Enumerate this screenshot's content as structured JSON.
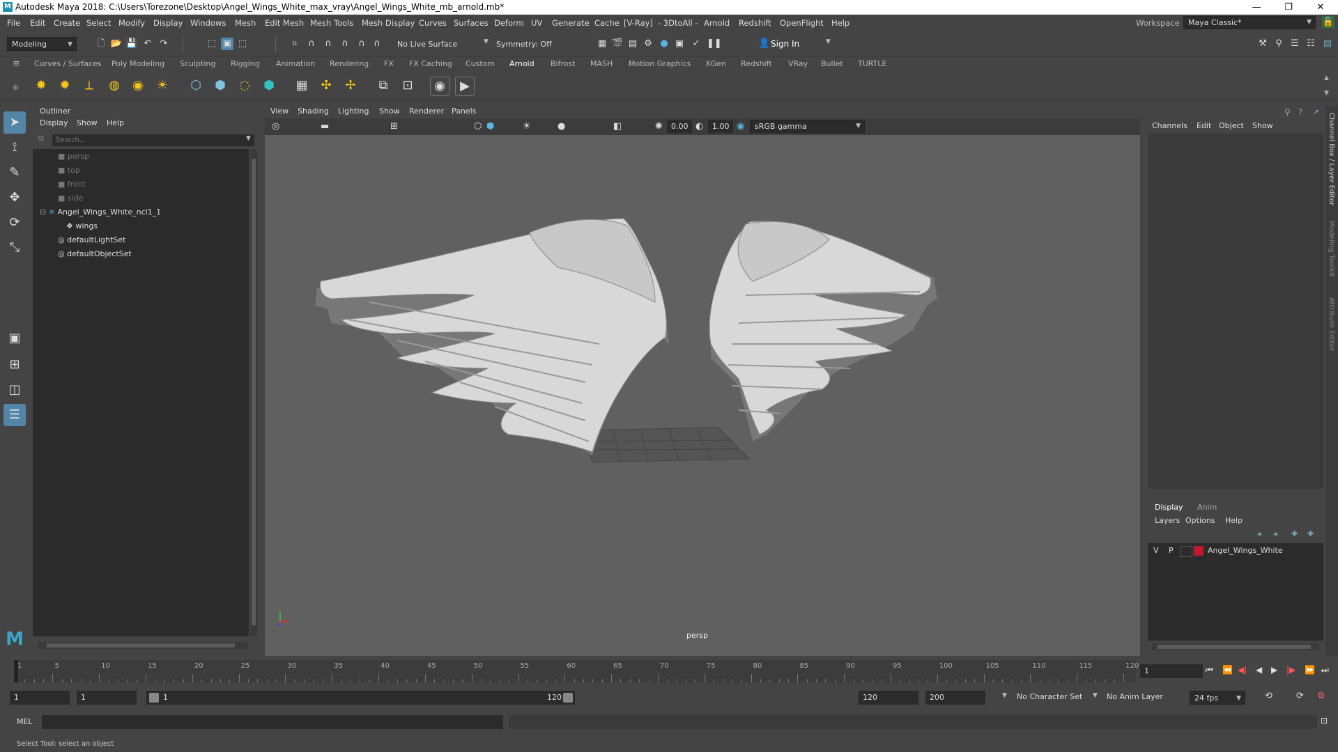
{
  "window": {
    "title": "Autodesk Maya 2018: C:\\Users\\Torezone\\Desktop\\Angel_Wings_White_max_vray\\Angel_Wings_White_mb_arnold.mb*",
    "minimize": "—",
    "maximize": "❐",
    "close": "✕"
  },
  "menubar": {
    "items": [
      "File",
      "Edit",
      "Create",
      "Select",
      "Modify",
      "Display",
      "Windows",
      "Mesh",
      "Edit Mesh",
      "Mesh Tools",
      "Mesh Display",
      "Curves",
      "Surfaces",
      "Deform",
      "UV",
      "Generate",
      "Cache",
      "[V-Ray]",
      "- 3DtoAll -",
      "Arnold",
      "Redshift",
      "OpenFlight",
      "Help"
    ],
    "workspace_label": "Workspace :",
    "workspace_value": "Maya Classic*"
  },
  "statusline": {
    "mode": "Modeling",
    "live_surface": "No Live Surface",
    "symmetry": "Symmetry: Off",
    "sign_in": "Sign In"
  },
  "shelf_tabs": [
    "Curves / Surfaces",
    "Poly Modeling",
    "Sculpting",
    "Rigging",
    "Animation",
    "Rendering",
    "FX",
    "FX Caching",
    "Custom",
    "Arnold",
    "Bifrost",
    "MASH",
    "Motion Graphics",
    "XGen",
    "Redshift",
    "VRay",
    "Bullet",
    "TURTLE"
  ],
  "shelf_active": "Arnold",
  "outliner": {
    "title": "Outliner",
    "menu": [
      "Display",
      "Show",
      "Help"
    ],
    "search_placeholder": "Search...",
    "items": [
      "persp",
      "top",
      "front",
      "side",
      "Angel_Wings_White_ncl1_1",
      "wings",
      "defaultLightSet",
      "defaultObjectSet"
    ]
  },
  "viewport": {
    "menu": [
      "View",
      "Shading",
      "Lighting",
      "Show",
      "Renderer",
      "Panels"
    ],
    "exposure": "0.00",
    "gamma": "1.00",
    "color_space": "sRGB gamma",
    "camera_label": "persp"
  },
  "channel_box": {
    "menu": [
      "Channels",
      "Edit",
      "Object",
      "Show"
    ],
    "side_tabs": [
      "Channel Box / Layer Editor",
      "Modeling Toolkit",
      "Attribute Editor"
    ],
    "layer_tabs": [
      "Display",
      "Anim"
    ],
    "layer_menu": [
      "Layers",
      "Options",
      "Help"
    ],
    "layer": {
      "v": "V",
      "p": "P",
      "name": "Angel_Wings_White",
      "color": "#c0182f"
    }
  },
  "timeline": {
    "ticks": [
      "1",
      "5",
      "10",
      "15",
      "20",
      "25",
      "30",
      "35",
      "40",
      "45",
      "50",
      "55",
      "60",
      "65",
      "70",
      "75",
      "80",
      "85",
      "90",
      "95",
      "100",
      "105",
      "110",
      "115",
      "120"
    ],
    "current_frame": "1"
  },
  "range": {
    "start": "1",
    "anim_start": "1",
    "slider_start": "1",
    "slider_end": "120",
    "end": "120",
    "anim_end": "200",
    "character_set": "No Character Set",
    "anim_layer": "No Anim Layer",
    "fps": "24 fps"
  },
  "command": {
    "label": "MEL"
  },
  "help_line": "Select Tool: select an object",
  "colors": {
    "accent": "#5285a6",
    "panel": "#444444",
    "viewport_bg": "#606060",
    "field_bg": "#2b2b2b"
  }
}
